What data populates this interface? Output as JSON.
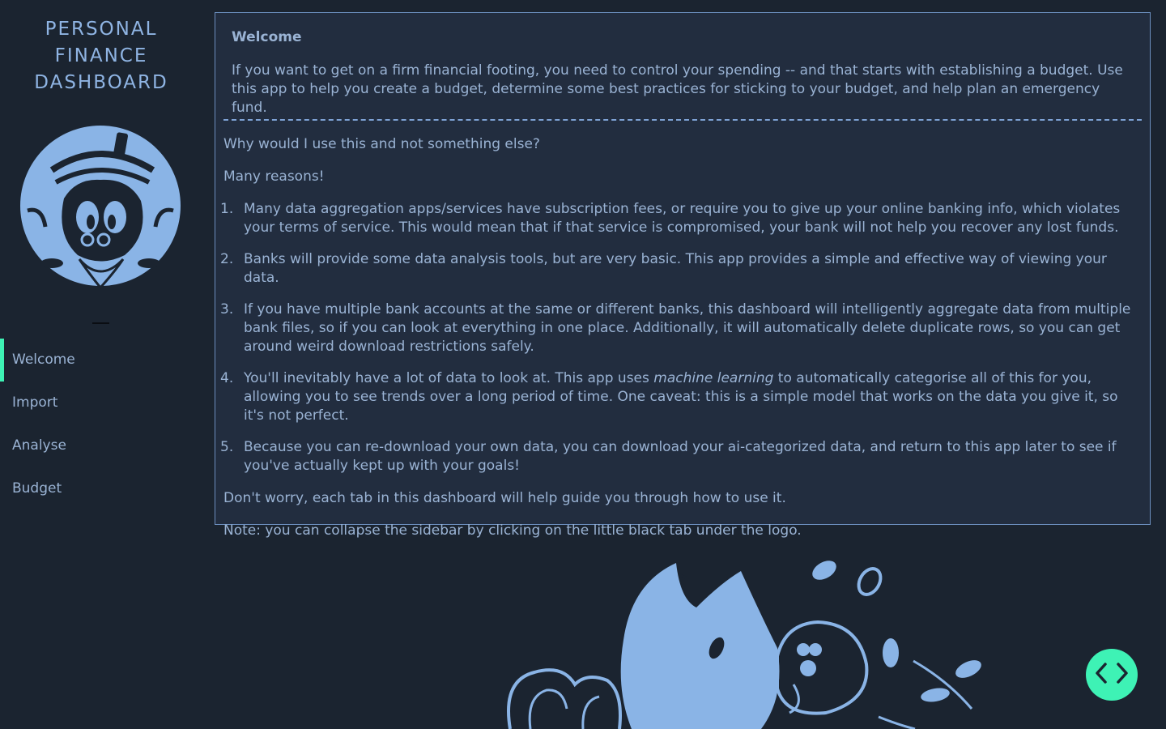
{
  "sidebar": {
    "brand_lines": [
      "PERSONAL",
      "FINANCE",
      "DASHBOARD"
    ],
    "nav": [
      {
        "label": "Welcome",
        "active": true
      },
      {
        "label": "Import",
        "active": false
      },
      {
        "label": "Analyse",
        "active": false
      },
      {
        "label": "Budget",
        "active": false
      }
    ]
  },
  "panel": {
    "title": "Welcome",
    "intro": "If you want to get on a firm financial footing, you need to control your spending -- and that starts with establishing a budget. Use this app to help you create a budget, determine some best practices for sticking to your budget, and help plan an emergency fund.",
    "question": "Why would I use this and not something else?",
    "many_reasons": "Many reasons!",
    "reasons": [
      {
        "num": "1.",
        "text": "Many data aggregation apps/services have subscription fees, or require you to give up your online banking info, which violates your terms of service. This would mean that if that service is compromised, your bank will not help you recover any lost funds."
      },
      {
        "num": "2.",
        "text": "Banks will provide some data analysis tools, but are very basic. This app provides a simple and effective way of viewing your data."
      },
      {
        "num": "3.",
        "text": "If you have multiple bank accounts at the same or different banks, this dashboard will intelligently aggregate data from multiple bank files, so if you can look at everything in one place. Additionally, it will automatically delete duplicate rows, so you can get around weird download restrictions safely."
      },
      {
        "num": "4.",
        "pre": "You'll inevitably have a lot of data to look at. This app uses ",
        "em": "machine learning",
        "post": " to automatically categorise all of this for you, allowing you to see trends over a long period of time. One caveat: this is a simple model that works on the data you give it, so it's not perfect."
      },
      {
        "num": "5.",
        "text": "Because you can re-download your own data, you can download your ai-categorized data, and return to this app later to see if you've actually kept up with your goals!"
      }
    ],
    "dont_worry": "Don't worry, each tab in this dashboard will help guide you through how to use it.",
    "note": "Note: you can collapse the sidebar by clicking on the little black tab under the logo."
  },
  "colors": {
    "background": "#1b2430",
    "panel": "#222d3f",
    "text": "#9ab3d4",
    "accent": "#3ef2b5",
    "illustration": "#8ab4e6"
  },
  "icons": {
    "fab": "code-brackets-icon",
    "logo": "duck-logo",
    "decoration": "duck-diving-illustration"
  }
}
